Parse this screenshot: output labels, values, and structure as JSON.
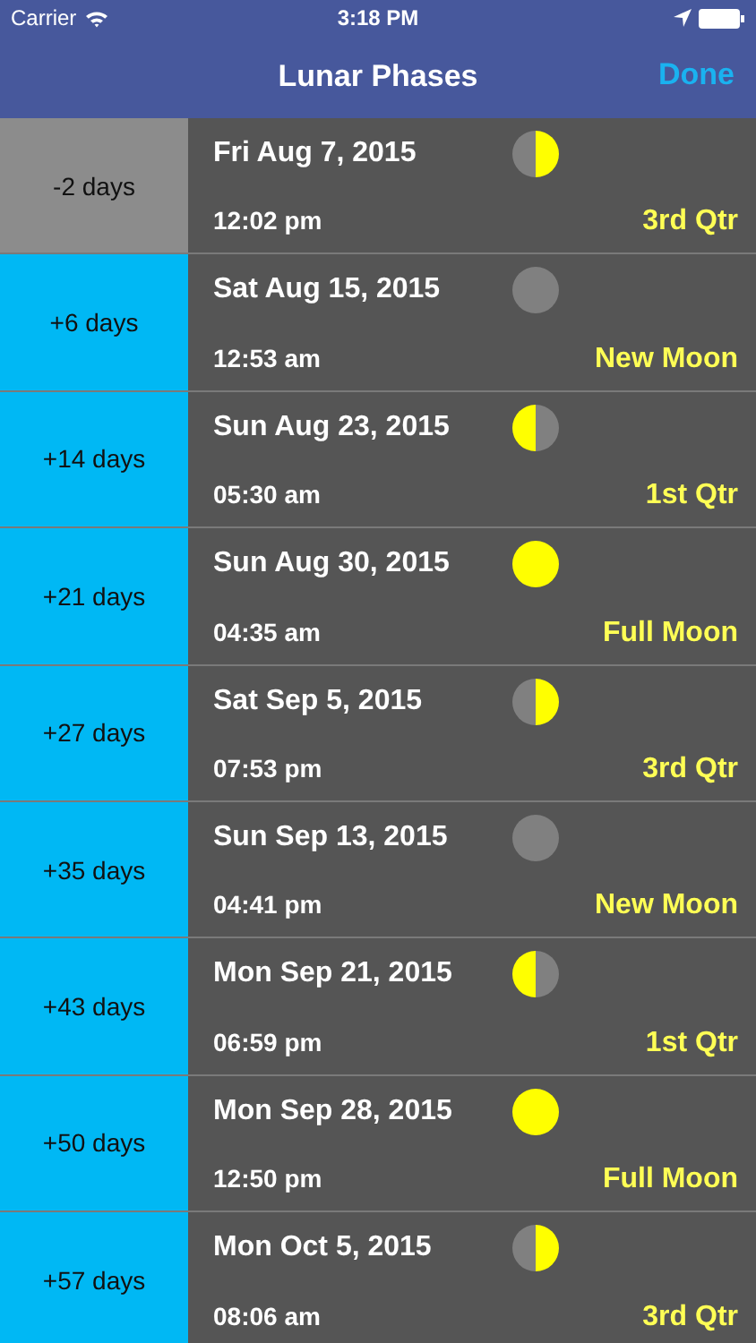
{
  "status_bar": {
    "carrier": "Carrier",
    "time": "3:18 PM"
  },
  "nav": {
    "title": "Lunar Phases",
    "done": "Done"
  },
  "rows": [
    {
      "offset": "-2 days",
      "past": true,
      "date": "Fri Aug 7, 2015",
      "time": "12:02 pm",
      "phase": "3rd Qtr",
      "kind": "third"
    },
    {
      "offset": "+6 days",
      "past": false,
      "date": "Sat Aug 15, 2015",
      "time": "12:53 am",
      "phase": "New Moon",
      "kind": "new"
    },
    {
      "offset": "+14 days",
      "past": false,
      "date": "Sun Aug 23, 2015",
      "time": "05:30 am",
      "phase": "1st Qtr",
      "kind": "first"
    },
    {
      "offset": "+21 days",
      "past": false,
      "date": "Sun Aug 30, 2015",
      "time": "04:35 am",
      "phase": "Full Moon",
      "kind": "full"
    },
    {
      "offset": "+27 days",
      "past": false,
      "date": "Sat Sep 5, 2015",
      "time": "07:53 pm",
      "phase": "3rd Qtr",
      "kind": "third"
    },
    {
      "offset": "+35 days",
      "past": false,
      "date": "Sun Sep 13, 2015",
      "time": "04:41 pm",
      "phase": "New Moon",
      "kind": "new"
    },
    {
      "offset": "+43 days",
      "past": false,
      "date": "Mon Sep 21, 2015",
      "time": "06:59 pm",
      "phase": "1st Qtr",
      "kind": "first"
    },
    {
      "offset": "+50 days",
      "past": false,
      "date": "Mon Sep 28, 2015",
      "time": "12:50 pm",
      "phase": "Full Moon",
      "kind": "full"
    },
    {
      "offset": "+57 days",
      "past": false,
      "date": "Mon Oct 5, 2015",
      "time": "08:06 am",
      "phase": "3rd Qtr",
      "kind": "third"
    }
  ]
}
